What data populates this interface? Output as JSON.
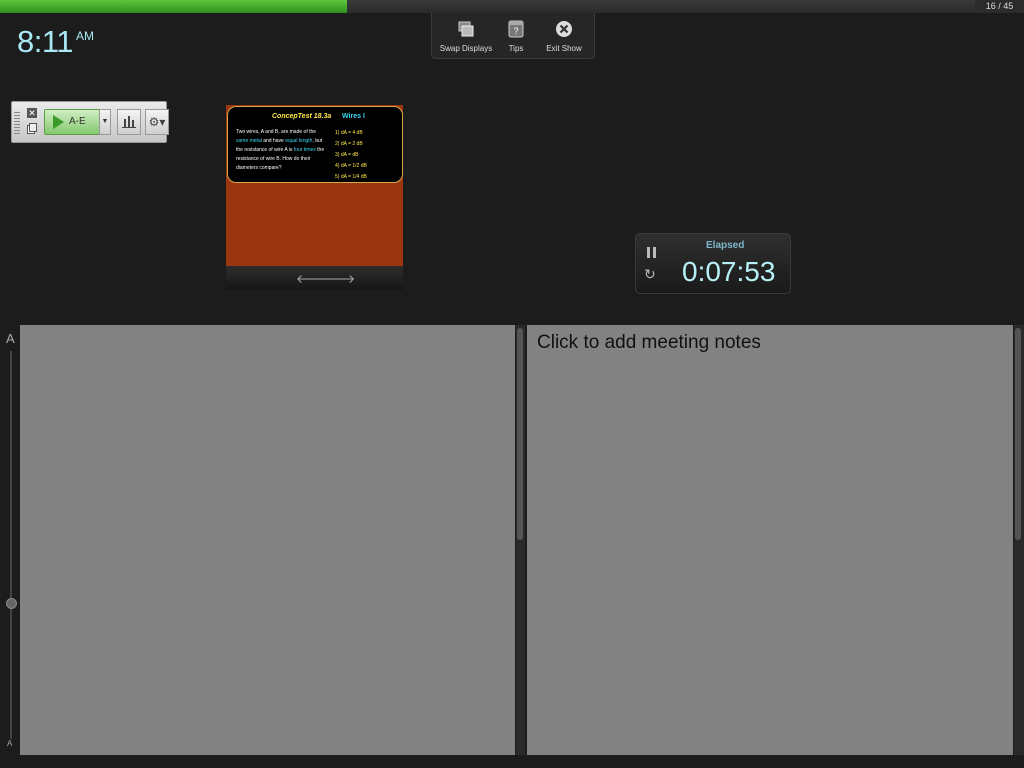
{
  "progress": {
    "fraction": 0.356,
    "slide_counter": "16 / 45",
    "colors": {
      "fill": "#4aa92e"
    }
  },
  "clock": {
    "time": "8:11",
    "ampm": "AM"
  },
  "toolbar": {
    "swap_displays": {
      "label": "Swap Displays",
      "icon": "swap-displays-icon"
    },
    "tips": {
      "label": "Tips",
      "icon": "help-icon"
    },
    "exit_show": {
      "label": "Exit Show",
      "icon": "close-circle-icon"
    }
  },
  "polling": {
    "start_label": "A-E"
  },
  "slide": {
    "title": "ConcepTest 18.3a",
    "subtitle": "Wires I",
    "question": {
      "part1": "Two wires, A and B, are made of the",
      "hl1": "same metal",
      "part2": "and have",
      "hl2": "equal length",
      "part3": ", but the resistance of wire A is",
      "hl3": "four times",
      "part4": "the resistance of wire B.  How do their diameters compare?"
    },
    "options": [
      "1)  dA  =  4 dB",
      "2)  dA  =  2 dB",
      "3)  dA  =  dB",
      "4)  dA  =  1/2 dB",
      "5)  dA  =  1/4 dB"
    ]
  },
  "timer": {
    "label": "Elapsed",
    "value": "0:07:53"
  },
  "font_slider": {
    "top_label": "A",
    "bottom_label": "A"
  },
  "meeting_notes": {
    "placeholder": "Click to add meeting notes"
  }
}
